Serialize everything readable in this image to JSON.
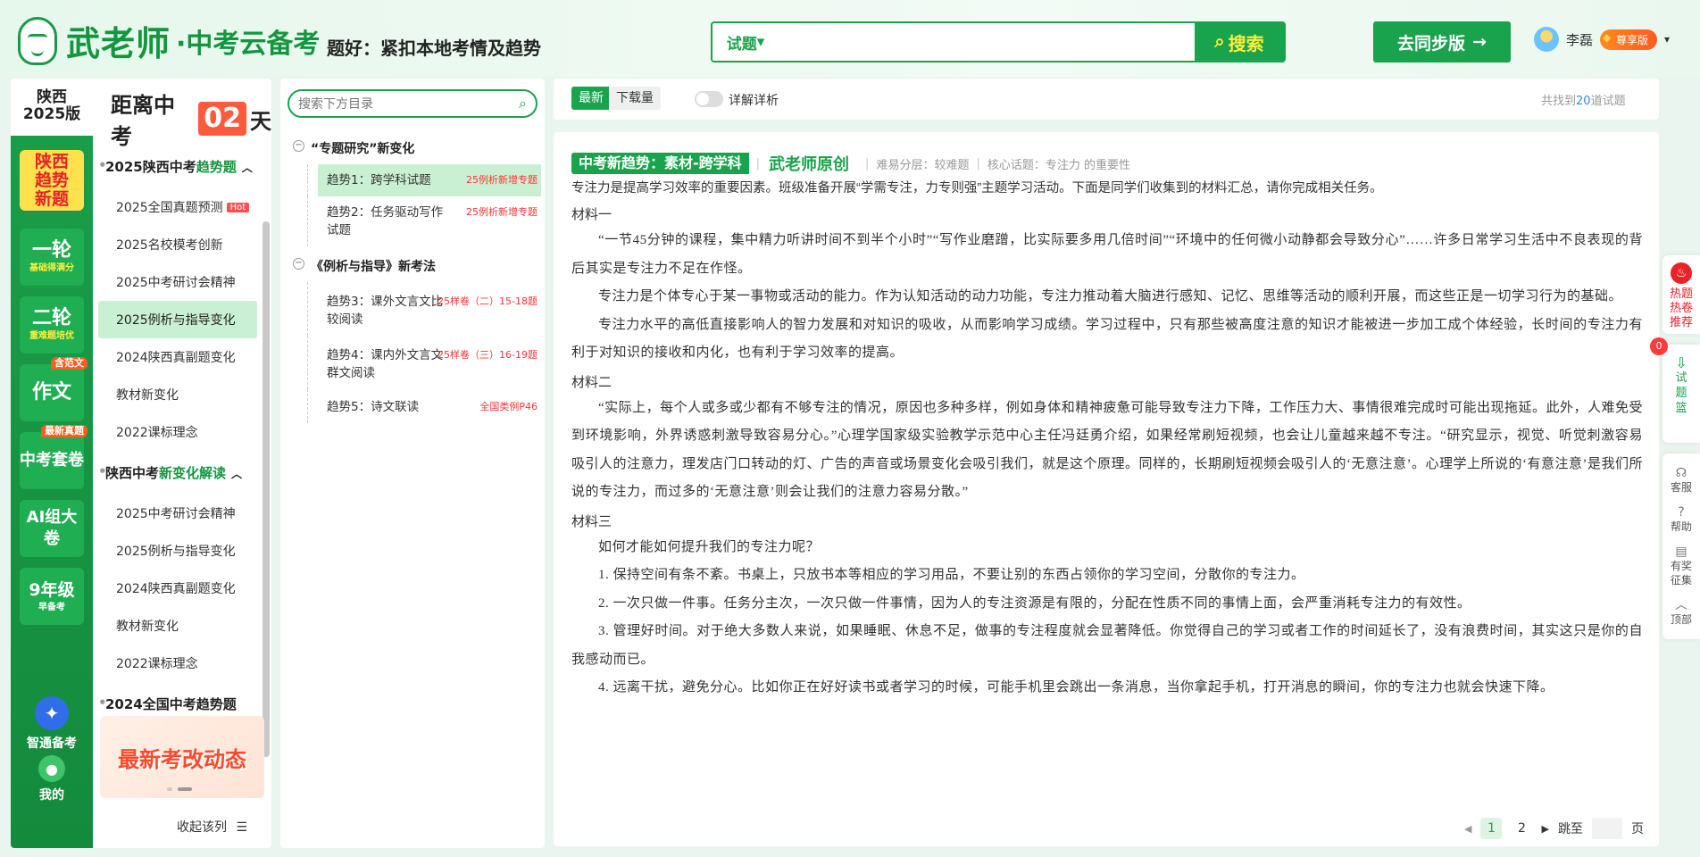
{
  "header": {
    "logo_text": "武老师",
    "logo_sub": "·中考云备考",
    "slogan": "题好：紧扣本地考情及趋势",
    "search_type": "试题",
    "search_placeholder": "",
    "search_button": "搜索",
    "sync_button": "去同步版",
    "user_name": "李磊",
    "vip_label": "尊享版"
  },
  "left": {
    "province_line1": "陕西",
    "province_line2": "2025版",
    "countdown_prefix": "距离中考",
    "countdown_days": "02",
    "countdown_suffix": "天",
    "nav": [
      {
        "big": "陕西\n趋势\n新题",
        "small": ""
      },
      {
        "big": "一轮",
        "small": "基础得满分"
      },
      {
        "big": "二轮",
        "small": "重难题培优"
      },
      {
        "big": "作文",
        "small": "",
        "tag": "含范文"
      },
      {
        "big": "中考套卷",
        "small": "",
        "tag": "最新真题"
      },
      {
        "big": "AI组大卷",
        "small": ""
      },
      {
        "big": "9年级",
        "small": "早备考"
      }
    ],
    "nav_bottom_1": "智通备考",
    "nav_bottom_2": "我的",
    "tree": {
      "group1_pre": "2025陕西中考",
      "group1_hl": "趋势题",
      "group1_items": [
        "2025全国真题预测",
        "2025名校模考创新",
        "2025中考研讨会精神",
        "2025例析与指导变化",
        "2024陕西真副题变化",
        "教材新变化",
        "2022课标理念"
      ],
      "hot": "Hot",
      "group2_pre": "陕西中考",
      "group2_hl": "新变化解读",
      "group2_items": [
        "2025中考研讨会精神",
        "2025例析与指导变化",
        "2024陕西真副题变化",
        "教材新变化",
        "2022课标理念"
      ],
      "group3": "2024全国中考趋势题"
    },
    "banner": "最新考改动态",
    "collapse": "收起该列"
  },
  "toc": {
    "search_placeholder": "搜索下方目录",
    "groups": [
      {
        "title": "“专题研究”新变化",
        "items": [
          {
            "label": "趋势1：跨学科试题",
            "note": "25例析新增专题"
          },
          {
            "label": "趋势2：任务驱动写作试题",
            "note": "25例析新增专题"
          }
        ]
      },
      {
        "title": "《例析与指导》新考法",
        "items": [
          {
            "label": "趋势3：课外文言文比较阅读",
            "note": "25样卷（二）15-18题"
          },
          {
            "label": "趋势4：课内外文言文群文阅读",
            "note": "25样卷（三）16-19题"
          },
          {
            "label": "趋势5：诗文联读",
            "note": "全国类例P46"
          }
        ]
      }
    ]
  },
  "filter": {
    "tab_latest": "最新",
    "tab_downloads": "下载量",
    "toggle_label": "详解详析",
    "found_pre": "共找到",
    "found_num": "20",
    "found_post": "道试题"
  },
  "question": {
    "tag": "中考新趋势：素材-跨学科",
    "original": "武老师原创",
    "difficulty": "难易分层：较难题",
    "topic": "核心话题：专注力 的重要性",
    "intro": "专注力是提高学习效率的重要因素。班级准备开展“学需专注，力专则强”主题学习活动。下面是同学们收集到的材料汇总，请你完成相关任务。",
    "m1_label": "材料一",
    "m1_p1": "“一节45分钟的课程，集中精力听讲时间不到半个小时”“写作业磨蹭，比实际要多用几倍时间”“环境中的任何微小动静都会导致分心”……许多日常学习生活中不良表现的背后其实是专注力不足在作怪。",
    "m1_p2": "专注力是个体专心于某一事物或活动的能力。作为认知活动的动力功能，专注力推动着大脑进行感知、记忆、思维等活动的顺利开展，而这些正是一切学习行为的基础。",
    "m1_p3": "专注力水平的高低直接影响人的智力发展和对知识的吸收，从而影响学习成绩。学习过程中，只有那些被高度注意的知识才能被进一步加工成个体经验，长时间的专注力有利于对知识的接收和内化，也有利于学习效率的提高。",
    "m2_label": "材料二",
    "m2_p1": "“实际上，每个人或多或少都有不够专注的情况，原因也多种多样，例如身体和精神疲惫可能导致专注力下降，工作压力大、事情很难完成时可能出现拖延。此外，人难免受到环境影响，外界诱惑刺激导致容易分心。”心理学国家级实验教学示范中心主任冯廷勇介绍，如果经常刷短视频，也会让儿童越来越不专注。“研究显示，视觉、听觉刺激容易吸引人的注意力，理发店门口转动的灯、广告的声音或场景变化会吸引我们，就是这个原理。同样的，长期刷短视频会吸引人的‘无意注意’。心理学上所说的‘有意注意’是我们所说的专注力，而过多的‘无意注意’则会让我们的注意力容易分散。”",
    "m3_label": "材料三",
    "m3_p0": "如何才能如何提升我们的专注力呢？",
    "m3_p1": "1. 保持空间有条不紊。书桌上，只放书本等相应的学习用品，不要让别的东西占领你的学习空间，分散你的专注力。",
    "m3_p2": "2. 一次只做一件事。任务分主次，一次只做一件事情，因为人的专注资源是有限的，分配在性质不同的事情上面，会严重消耗专注力的有效性。",
    "m3_p3": "3. 管理好时间。对于绝大多数人来说，如果睡眠、休息不足，做事的专注程度就会显著降低。你觉得自己的学习或者工作的时间延长了，没有浪费时间，其实这只是你的自我感动而已。",
    "m3_p4": "4. 远离干扰，避免分心。比如你正在好好读书或者学习的时候，可能手机里会跳出一条消息，当你拿起手机，打开消息的瞬间，你的专注力也就会快速下降。"
  },
  "pager": {
    "p1": "1",
    "p2": "2",
    "jump_label": "跳至",
    "page_label": "页"
  },
  "float": {
    "hot": "热题\n热卷\n推荐",
    "basket": "试\n题\n篮",
    "basket_count": "0",
    "service": "客服",
    "help": "帮助",
    "reward": "有奖\n征集",
    "top": "顶部"
  },
  "colors": {
    "brand_green": "#19a34c",
    "accent_red": "#e8212a",
    "highlight_bg": "#c9f0d3"
  }
}
